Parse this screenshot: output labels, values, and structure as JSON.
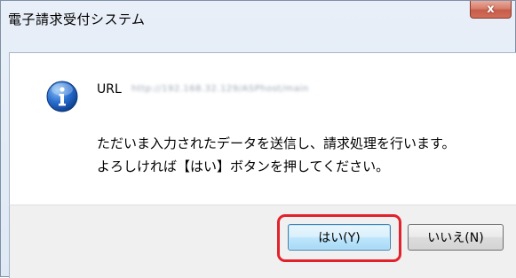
{
  "window": {
    "title": "電子請求受付システム",
    "close_label": "x"
  },
  "dialog": {
    "icon": "info-icon",
    "url_label": "URL",
    "url_value": "http://192.168.32.129/ASPhost/main",
    "message_line1": "ただいま入力されたデータを送信し、請求処理を行います。",
    "message_line2": "よろしければ【はい】ボタンを押してください。"
  },
  "buttons": {
    "yes_label": "はい(Y)",
    "no_label": "いいえ(N)"
  },
  "colors": {
    "highlight": "#e3212b",
    "info_icon": "#1a5cb8"
  }
}
